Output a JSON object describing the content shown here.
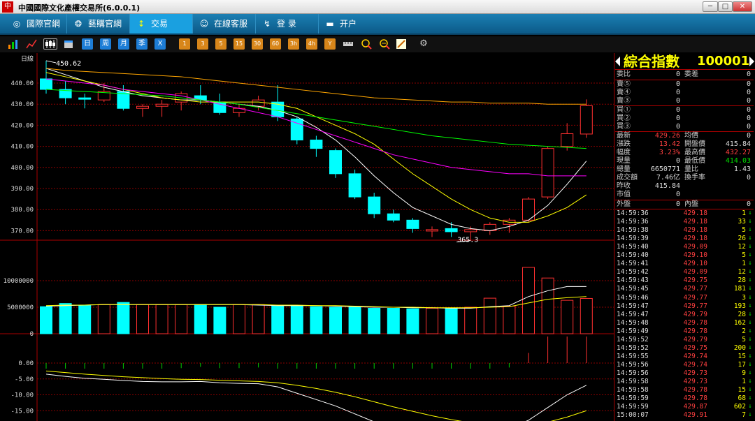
{
  "window": {
    "title": "中國國際文化產權交易所(6.0.0.1)",
    "icon_text": "中",
    "min_label": "─",
    "max_label": "□",
    "close_label": "✕"
  },
  "nav": [
    {
      "label": "國際官網",
      "icon": "globe-icon",
      "glyph": "◎"
    },
    {
      "label": "藝購官網",
      "icon": "art-icon",
      "glyph": "❂"
    },
    {
      "label": "交易",
      "icon": "trade-icon",
      "glyph": "↕"
    },
    {
      "label": "在線客服",
      "icon": "chat-icon",
      "glyph": "☺"
    },
    {
      "label": "登  录",
      "icon": "login-icon",
      "glyph": "↯"
    },
    {
      "label": "开户",
      "icon": "account-icon",
      "glyph": "▬"
    }
  ],
  "toolbar": {
    "period_labels": [
      "日",
      "周",
      "月",
      "季",
      "X"
    ],
    "minute_labels": [
      "1",
      "3",
      "5",
      "15",
      "30",
      "60",
      "3h",
      "4h",
      "Y"
    ]
  },
  "chart": {
    "period_label": "日線",
    "max_label": "450.62",
    "min_label": "365.3"
  },
  "chart_data": {
    "type": "candlestick",
    "price_axis": {
      "ticks": [
        440,
        430,
        420,
        410,
        400,
        390,
        380,
        370
      ],
      "labels": [
        "440.00",
        "430.00",
        "420.00",
        "410.00",
        "400.00",
        "390.00",
        "380.00",
        "370.00"
      ],
      "range": [
        364,
        450
      ]
    },
    "volume_axis": {
      "ticks": [
        10000000,
        5000000,
        0
      ],
      "labels": [
        "10000000",
        "5000000",
        "0"
      ]
    },
    "indicator_axis": {
      "ticks": [
        0,
        -5,
        -10,
        -15
      ],
      "labels": [
        "0.00",
        "-5.00",
        "-10.00",
        "-15.00"
      ]
    },
    "candles": [
      {
        "o": 442,
        "h": 450.62,
        "l": 435,
        "c": 437
      },
      {
        "o": 437,
        "h": 441,
        "l": 430,
        "c": 433
      },
      {
        "o": 433,
        "h": 435,
        "l": 428,
        "c": 432.5
      },
      {
        "o": 432,
        "h": 440,
        "l": 431,
        "c": 436
      },
      {
        "o": 436,
        "h": 439,
        "l": 427,
        "c": 428
      },
      {
        "o": 428,
        "h": 430,
        "l": 424,
        "c": 429
      },
      {
        "o": 429,
        "h": 432,
        "l": 424,
        "c": 430
      },
      {
        "o": 431,
        "h": 436,
        "l": 427,
        "c": 435
      },
      {
        "o": 434,
        "h": 439,
        "l": 430,
        "c": 432
      },
      {
        "o": 431,
        "h": 435,
        "l": 425,
        "c": 426
      },
      {
        "o": 426,
        "h": 430,
        "l": 424,
        "c": 428
      },
      {
        "o": 429,
        "h": 434,
        "l": 427,
        "c": 432
      },
      {
        "o": 431,
        "h": 439,
        "l": 422,
        "c": 424
      },
      {
        "o": 423,
        "h": 424,
        "l": 411,
        "c": 413
      },
      {
        "o": 413,
        "h": 415,
        "l": 405,
        "c": 409
      },
      {
        "o": 408,
        "h": 409,
        "l": 395,
        "c": 397
      },
      {
        "o": 397,
        "h": 399,
        "l": 385,
        "c": 386
      },
      {
        "o": 386,
        "h": 388,
        "l": 376,
        "c": 378
      },
      {
        "o": 378,
        "h": 380,
        "l": 374,
        "c": 375
      },
      {
        "o": 375,
        "h": 376,
        "l": 369,
        "c": 371
      },
      {
        "o": 370,
        "h": 372,
        "l": 367,
        "c": 370.5
      },
      {
        "o": 371,
        "h": 374,
        "l": 367,
        "c": 369.5
      },
      {
        "o": 369.5,
        "h": 372,
        "l": 365.3,
        "c": 370.5
      },
      {
        "o": 370,
        "h": 374,
        "l": 368,
        "c": 373
      },
      {
        "o": 373,
        "h": 376,
        "l": 369,
        "c": 375
      },
      {
        "o": 375,
        "h": 386,
        "l": 374,
        "c": 385
      },
      {
        "o": 386,
        "h": 410,
        "l": 385,
        "c": 409
      },
      {
        "o": 410,
        "h": 421,
        "l": 408,
        "c": 416
      },
      {
        "o": 415.84,
        "h": 432.27,
        "l": 414.03,
        "c": 429.26
      }
    ],
    "volume": [
      5100000,
      5700000,
      5400000,
      5500000,
      5900000,
      5500000,
      5500000,
      5500000,
      5500000,
      5000000,
      5500000,
      5500000,
      5200000,
      5200000,
      5100000,
      5000000,
      5100000,
      4800000,
      4800000,
      4700000,
      4800000,
      4800000,
      5000000,
      6700000,
      5200000,
      12500000,
      10500000,
      6300000,
      6650771
    ],
    "ma": [
      {
        "name": "MA5",
        "color": "#ffffff",
        "values": [
          447,
          444,
          441,
          438,
          436,
          434,
          433,
          432,
          432,
          431,
          430,
          429,
          427,
          424,
          419,
          413,
          405,
          396,
          388,
          381,
          377,
          373,
          371,
          370,
          372,
          375,
          382,
          392,
          403
        ]
      },
      {
        "name": "MA10",
        "color": "#ffff00",
        "values": [
          445,
          443,
          441,
          439,
          437,
          435,
          433,
          432,
          431,
          431,
          431,
          431,
          430,
          428,
          424,
          420,
          416,
          411,
          404,
          397,
          391,
          385,
          380,
          376,
          374,
          374,
          377,
          381,
          387
        ]
      },
      {
        "name": "MA20",
        "color": "#ff00ff",
        "values": [
          442,
          441,
          440,
          439,
          437,
          436,
          435,
          434,
          432,
          430,
          428,
          426,
          424,
          421,
          418,
          415,
          412,
          409,
          406,
          404,
          402,
          400,
          399,
          398,
          397,
          397,
          396,
          396,
          396
        ]
      },
      {
        "name": "MA40",
        "color": "#00ff00",
        "values": [
          437,
          436.5,
          436,
          435.5,
          435,
          434.5,
          434,
          433,
          432,
          431,
          430,
          428.5,
          427,
          425.5,
          424,
          422.5,
          421,
          419.5,
          418,
          416.5,
          415,
          414,
          413,
          412,
          411,
          410.5,
          410,
          409.5,
          409
        ]
      },
      {
        "name": "MA60",
        "color": "#ffa500",
        "values": [
          447,
          446,
          445.5,
          445,
          444.5,
          444,
          443.5,
          443,
          442,
          441,
          440,
          439,
          438,
          437,
          436,
          435,
          434,
          433,
          432.5,
          432,
          431.5,
          431,
          431,
          430.5,
          430.5,
          430.5,
          430,
          430,
          430
        ]
      }
    ],
    "volume_ma": [
      {
        "name": "VMA5",
        "color": "#ffffff",
        "values": [
          5200000,
          5300000,
          5400000,
          5500000,
          5500000,
          5500000,
          5500000,
          5500000,
          5500000,
          5500000,
          5500000,
          5400000,
          5300000,
          5300000,
          5300000,
          5200000,
          5100000,
          5000000,
          5000000,
          4900000,
          4900000,
          4800000,
          4800000,
          5100000,
          5300000,
          7000000,
          8100000,
          8900000,
          8900000
        ]
      },
      {
        "name": "VMA10",
        "color": "#ffff00",
        "values": [
          5300000,
          5400000,
          5400000,
          5500000,
          5500000,
          5500000,
          5500000,
          5500000,
          5500000,
          5500000,
          5500000,
          5500000,
          5400000,
          5400000,
          5300000,
          5300000,
          5200000,
          5100000,
          5000000,
          5000000,
          4900000,
          4900000,
          4900000,
          5000000,
          5100000,
          5800000,
          6500000,
          6800000,
          7000000
        ]
      }
    ],
    "indicator": [
      {
        "name": "DIF",
        "color": "#ffffff",
        "values": [
          -3.5,
          -4.2,
          -4.8,
          -5.1,
          -5.5,
          -5.8,
          -5.9,
          -5.9,
          -5.8,
          -6.2,
          -6.4,
          -6.5,
          -7.5,
          -9.5,
          -11.5,
          -13.5,
          -16,
          -18.5,
          -20.5,
          -22,
          -23,
          -23.5,
          -23,
          -22,
          -20.5,
          -18,
          -14,
          -10,
          -7
        ]
      },
      {
        "name": "DEA",
        "color": "#ffff00",
        "values": [
          -2.5,
          -3,
          -3.5,
          -3.9,
          -4.3,
          -4.6,
          -4.9,
          -5.1,
          -5.2,
          -5.4,
          -5.6,
          -5.8,
          -6.2,
          -7,
          -8,
          -9.2,
          -10.6,
          -12.2,
          -13.8,
          -15.2,
          -16.6,
          -17.8,
          -18.8,
          -19.5,
          -19.8,
          -19.6,
          -18.6,
          -17,
          -15
        ]
      }
    ],
    "histogram": [
      -2,
      -2.4,
      -2.6,
      -2.4,
      -2.4,
      -2.4,
      -2,
      -1.6,
      -1.2,
      -1.6,
      -1.6,
      -1.4,
      -2.6,
      -5,
      -7,
      -8.6,
      -10.8,
      -12.6,
      -13.4,
      -13.6,
      -12.8,
      -11.4,
      -8.4,
      -5,
      -1.4,
      3.2,
      9.2,
      14,
      16
    ]
  },
  "quote": {
    "name": "綜合指數",
    "code": "100001",
    "weibi": {
      "label": "委比",
      "value": "0"
    },
    "weicha": {
      "label": "委差",
      "value": "0"
    },
    "sell": [
      {
        "label": "賣⑤",
        "price": "0",
        "vol": "0"
      },
      {
        "label": "賣④",
        "price": "0",
        "vol": "0"
      },
      {
        "label": "賣③",
        "price": "0",
        "vol": "0"
      }
    ],
    "buy": [
      {
        "label": "買①",
        "price": "0",
        "vol": "0"
      },
      {
        "label": "買②",
        "price": "0",
        "vol": "0"
      },
      {
        "label": "買③",
        "price": "0",
        "vol": "0"
      }
    ],
    "stats": [
      {
        "k1": "最新",
        "v1": "429.26",
        "c1": "red",
        "k2": "均價",
        "v2": "0",
        "c2": "white"
      },
      {
        "k1": "漲跌",
        "v1": "13.42",
        "c1": "red",
        "k2": "開盤價",
        "v2": "415.84",
        "c2": "white"
      },
      {
        "k1": "幅度",
        "v1": "3.23%",
        "c1": "red",
        "k2": "最高價",
        "v2": "432.27",
        "c2": "red"
      },
      {
        "k1": "現量",
        "v1": "0",
        "c1": "white",
        "k2": "最低價",
        "v2": "414.03",
        "c2": "green"
      },
      {
        "k1": "總量",
        "v1": "6650771",
        "c1": "white",
        "k2": "量比",
        "v2": "1.43",
        "c2": "white"
      },
      {
        "k1": "成交額",
        "v1": "7.46亿",
        "c1": "white",
        "k2": "換手率",
        "v2": "0",
        "c2": "white"
      },
      {
        "k1": "昨收",
        "v1": "415.84",
        "c1": "white",
        "k2": "",
        "v2": "",
        "c2": "white"
      },
      {
        "k1": "市值",
        "v1": "0",
        "c1": "white",
        "k2": "",
        "v2": "",
        "c2": "white"
      }
    ],
    "outer": {
      "label": "外盤",
      "value": "0"
    },
    "inner": {
      "label": "內盤",
      "value": "0"
    }
  },
  "ticks": [
    {
      "time": "14:59:36",
      "price": "429.18",
      "vol": "1",
      "dir": "↓",
      "dcolor": "#00e000"
    },
    {
      "time": "14:59:36",
      "price": "429.18",
      "vol": "33",
      "dir": "↓",
      "dcolor": "#00e000"
    },
    {
      "time": "14:59:38",
      "price": "429.18",
      "vol": "5",
      "dir": "↓",
      "dcolor": "#00e000"
    },
    {
      "time": "14:59:39",
      "price": "429.18",
      "vol": "26",
      "dir": "↓",
      "dcolor": "#00e000"
    },
    {
      "time": "14:59:40",
      "price": "429.09",
      "vol": "12",
      "dir": "↓",
      "dcolor": "#00e000"
    },
    {
      "time": "14:59:40",
      "price": "429.10",
      "vol": "5",
      "dir": "↓",
      "dcolor": "#00e000"
    },
    {
      "time": "14:59:41",
      "price": "429.10",
      "vol": "1",
      "dir": "↓",
      "dcolor": "#00e000"
    },
    {
      "time": "14:59:42",
      "price": "429.09",
      "vol": "12",
      "dir": "↓",
      "dcolor": "#00e000"
    },
    {
      "time": "14:59:43",
      "price": "429.75",
      "vol": "28",
      "dir": "↓",
      "dcolor": "#00e000"
    },
    {
      "time": "14:59:45",
      "price": "429.77",
      "vol": "181",
      "dir": "↓",
      "dcolor": "#00e000"
    },
    {
      "time": "14:59:46",
      "price": "429.77",
      "vol": "3",
      "dir": "↓",
      "dcolor": "#00e000"
    },
    {
      "time": "14:59:47",
      "price": "429.77",
      "vol": "193",
      "dir": "↓",
      "dcolor": "#00e000"
    },
    {
      "time": "14:59:47",
      "price": "429.79",
      "vol": "28",
      "dir": "↓",
      "dcolor": "#00e000"
    },
    {
      "time": "14:59:48",
      "price": "429.78",
      "vol": "162",
      "dir": "↓",
      "dcolor": "#00e000"
    },
    {
      "time": "14:59:49",
      "price": "429.78",
      "vol": "2",
      "dir": "↓",
      "dcolor": "#00e000"
    },
    {
      "time": "14:59:52",
      "price": "429.79",
      "vol": "5",
      "dir": "↓",
      "dcolor": "#00e000"
    },
    {
      "time": "14:59:52",
      "price": "429.75",
      "vol": "200",
      "dir": "↓",
      "dcolor": "#00e000"
    },
    {
      "time": "14:59:55",
      "price": "429.74",
      "vol": "15",
      "dir": "↓",
      "dcolor": "#00e000"
    },
    {
      "time": "14:59:56",
      "price": "429.74",
      "vol": "17",
      "dir": "↓",
      "dcolor": "#00e000"
    },
    {
      "time": "14:59:56",
      "price": "429.73",
      "vol": "9",
      "dir": "↓",
      "dcolor": "#00e000"
    },
    {
      "time": "14:59:58",
      "price": "429.73",
      "vol": "1",
      "dir": "↓",
      "dcolor": "#00e000"
    },
    {
      "time": "14:59:58",
      "price": "429.78",
      "vol": "15",
      "dir": "↓",
      "dcolor": "#00e000"
    },
    {
      "time": "14:59:59",
      "price": "429.78",
      "vol": "68",
      "dir": "↓",
      "dcolor": "#00e000"
    },
    {
      "time": "14:59:59",
      "price": "429.87",
      "vol": "602",
      "dir": "↓",
      "dcolor": "#00e000"
    },
    {
      "time": "15:00:07",
      "price": "429.91",
      "vol": "7",
      "dir": "↓",
      "dcolor": "#00e000"
    }
  ],
  "colors": {
    "up": "#ff3030",
    "down": "#00ffff",
    "grid": "#8b0000"
  }
}
